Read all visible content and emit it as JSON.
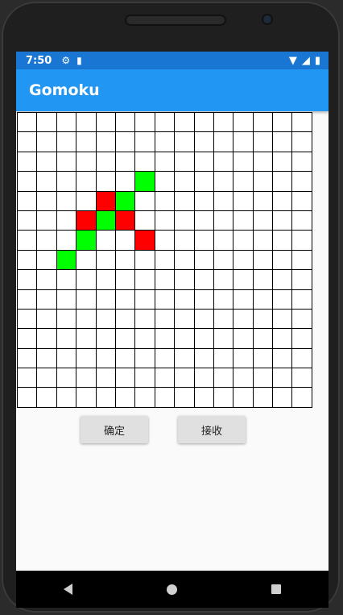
{
  "status_bar": {
    "time": "7:50",
    "icons_left": [
      "gear-icon",
      "sd-card-icon"
    ],
    "icons_right": [
      "wifi-icon",
      "signal-icon",
      "battery-icon"
    ]
  },
  "app_bar": {
    "title": "Gomoku"
  },
  "board": {
    "rows": 15,
    "cols": 15,
    "colors": {
      "player1": "#ff0000",
      "player2": "#00ff00",
      "empty": "#ffffff"
    },
    "red_stones": [
      [
        4,
        4
      ],
      [
        5,
        3
      ],
      [
        5,
        5
      ],
      [
        6,
        6
      ]
    ],
    "green_stones": [
      [
        3,
        6
      ],
      [
        4,
        5
      ],
      [
        5,
        4
      ],
      [
        6,
        3
      ],
      [
        7,
        2
      ]
    ]
  },
  "buttons": {
    "confirm": "确定",
    "receive": "接收"
  }
}
